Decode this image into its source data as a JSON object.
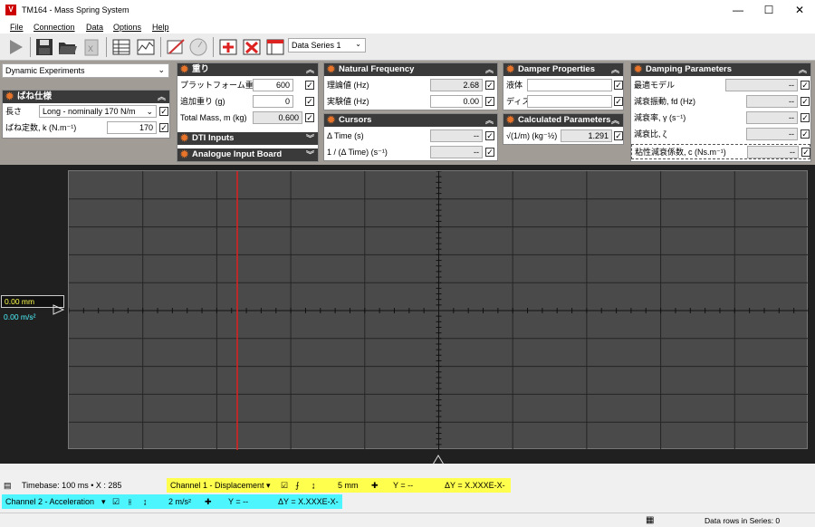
{
  "window": {
    "title": "TM164 - Mass Spring System"
  },
  "menu": [
    "File",
    "Connection",
    "Data",
    "Options",
    "Help"
  ],
  "toolbar": {
    "series": "Data Series 1"
  },
  "experiment_select": "Dynamic Experiments",
  "spring": {
    "header": "ばね仕様",
    "length_label": "長さ",
    "length_value": "Long - nominally 170 N/m",
    "constant_label": "ばね定数, k  (N.m⁻¹)",
    "constant_value": "170"
  },
  "mass": {
    "header": "重り",
    "platform_label": "プラットフォーム重さ (g)",
    "platform_value": "600",
    "added_label": "追加重り  (g)",
    "added_value": "0",
    "total_label": "Total Mass, m  (kg)",
    "total_value": "0.600",
    "dti_header": "DTI Inputs",
    "analogue_header": "Analogue Input Board"
  },
  "natural": {
    "header": "Natural Frequency",
    "theory_label": "理論値  (Hz)",
    "theory_value": "2.68",
    "exp_label": "実験値  (Hz)",
    "exp_value": "0.00"
  },
  "cursors": {
    "header": "Cursors",
    "dt_label": "Δ Time  (s)",
    "dt_value": "--",
    "inv_label": "1 / (Δ Time)  (s⁻¹)",
    "inv_value": "--"
  },
  "damper": {
    "header": "Damper Properties",
    "fluid_label": "液体",
    "disc_label": "ディス",
    "fluid_value": "",
    "disc_value": ""
  },
  "calc": {
    "header": "Calculated Parameters",
    "sqrt_label": "√(1/m)  (kg⁻½)",
    "sqrt_value": "1.291"
  },
  "damping": {
    "header": "Damping Parameters",
    "model_label": "最適モデル",
    "model_value": "--",
    "fd_label": "減衰振動, fd  (Hz)",
    "fd_value": "--",
    "gamma_label": "減衰率, γ  (s⁻¹)",
    "gamma_value": "--",
    "zeta_label": "減衰比, ζ",
    "zeta_value": "--",
    "c_label": "粘性減衰係数, c  (Ns.m⁻¹)",
    "c_value": "--"
  },
  "scope": {
    "readout_mm": "0.00 mm",
    "readout_ms2": "0.00 m/s²",
    "timebase": "Timebase:  100 ms  •  X :  285",
    "ch1": {
      "label": "Channel 1 - Displacement",
      "scale": "5 mm",
      "y": "Y = --",
      "dy": "ΔY = X.XXXE-X-",
      "color": "#ffff4d"
    },
    "ch2": {
      "label": "Channel 2 - Acceleration",
      "scale": "2 m/s²",
      "y": "Y = --",
      "dy": "ΔY = X.XXXE-X-",
      "color": "#4df5ff"
    }
  },
  "status": {
    "rows": "Data rows in Series: 0"
  }
}
